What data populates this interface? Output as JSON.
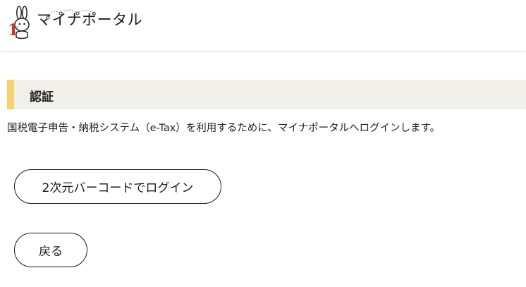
{
  "header": {
    "logo_text": "マイナポータル",
    "logo_icon": "mynaportal-rabbit-logo-icon",
    "logo_number": "1"
  },
  "section": {
    "title": "認証"
  },
  "main": {
    "description": "国税電子申告・納税システム（e-Tax）を利用するために、マイナポータルへログインします。",
    "qr_login_label": "2次元バーコードでログイン",
    "back_label": "戻る"
  },
  "colors": {
    "heading_bg": "#f1efe9",
    "heading_accent": "#f5d36a",
    "logo_accent": "#c0392b"
  }
}
